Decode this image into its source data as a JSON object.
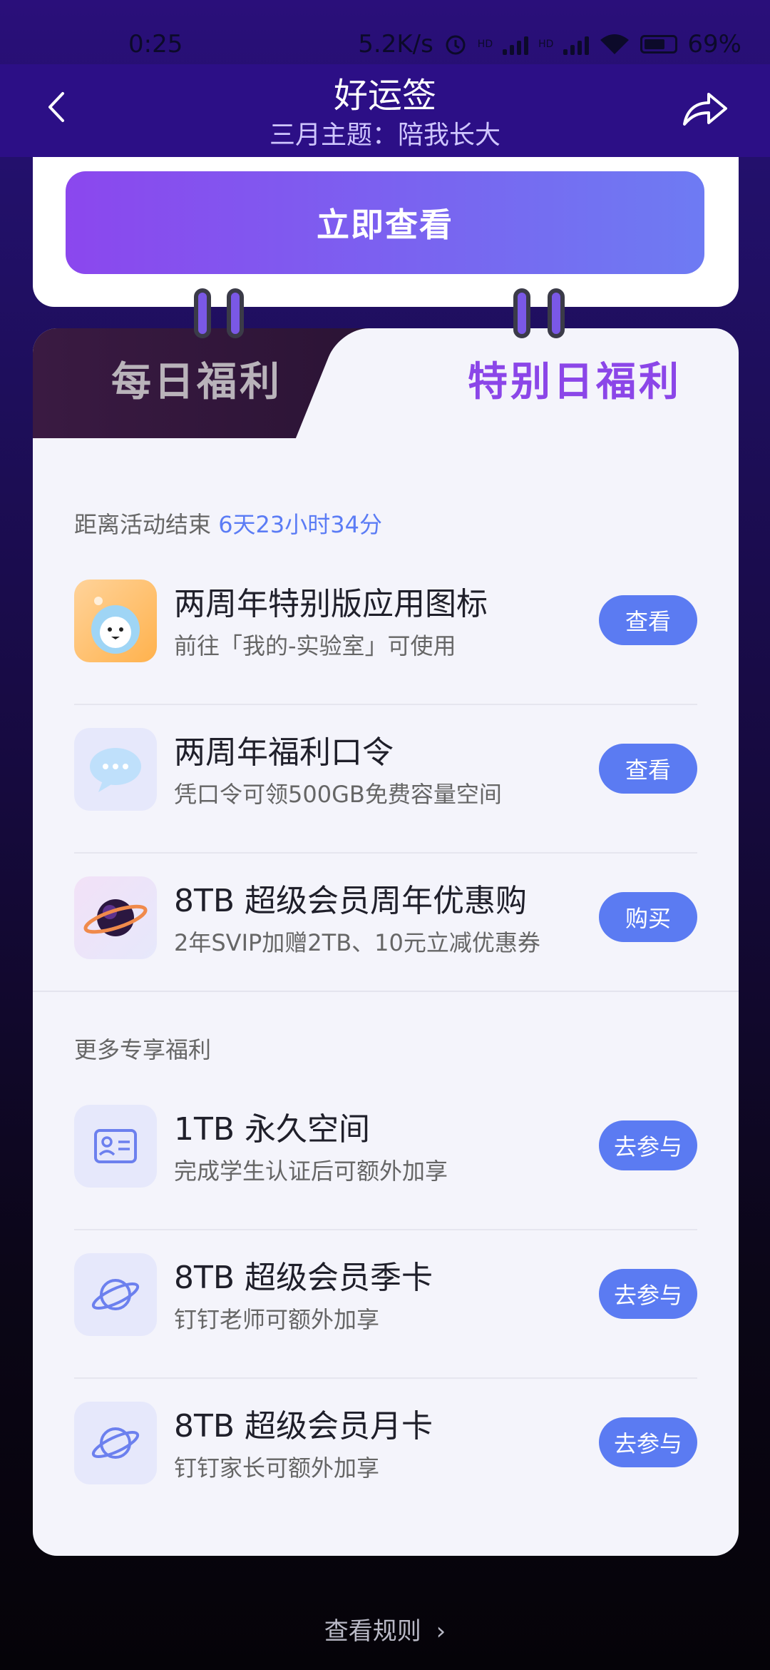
{
  "status_bar": {
    "time": "0:25",
    "speed": "5.2K/s",
    "hd1": "HD",
    "hd2": "HD",
    "battery": "69%"
  },
  "header": {
    "title": "好运签",
    "subtitle": "三月主题：陪我长大",
    "back_icon": "chevron-left-icon",
    "share_icon": "share-icon"
  },
  "top_card": {
    "view_now_label": "立即查看"
  },
  "tabs": {
    "daily": "每日福利",
    "special": "特别日福利",
    "active": "special"
  },
  "countdown": {
    "label": "距离活动结束",
    "value": "6天23小时34分"
  },
  "special_items": [
    {
      "name": "两周年特别版应用图标",
      "desc": "前往「我的-实验室」可使用",
      "button": "查看",
      "icon": "app-icon-anniversary"
    },
    {
      "name": "两周年福利口令",
      "desc": "凭口令可领500GB免费容量空间",
      "button": "查看",
      "icon": "chat-bubble-icon"
    },
    {
      "name": "8TB 超级会员周年优惠购",
      "desc": "2年SVIP加赠2TB、10元立减优惠券",
      "button": "购买",
      "icon": "planet-icon"
    }
  ],
  "more_section": {
    "label": "更多专享福利"
  },
  "more_items": [
    {
      "name": "1TB 永久空间",
      "desc": "完成学生认证后可额外加享",
      "button": "去参与",
      "icon": "id-card-icon"
    },
    {
      "name": "8TB 超级会员季卡",
      "desc": "钉钉老师可额外加享",
      "button": "去参与",
      "icon": "planet-outline-icon"
    },
    {
      "name": "8TB 超级会员月卡",
      "desc": "钉钉家长可额外加享",
      "button": "去参与",
      "icon": "planet-outline-icon"
    }
  ],
  "footer": {
    "rules_label": "查看规则",
    "rules_arrow": "›"
  },
  "colors": {
    "accent": "#5b7bf2",
    "header": "#2c0f86",
    "tab_active": "#8b46e8"
  }
}
